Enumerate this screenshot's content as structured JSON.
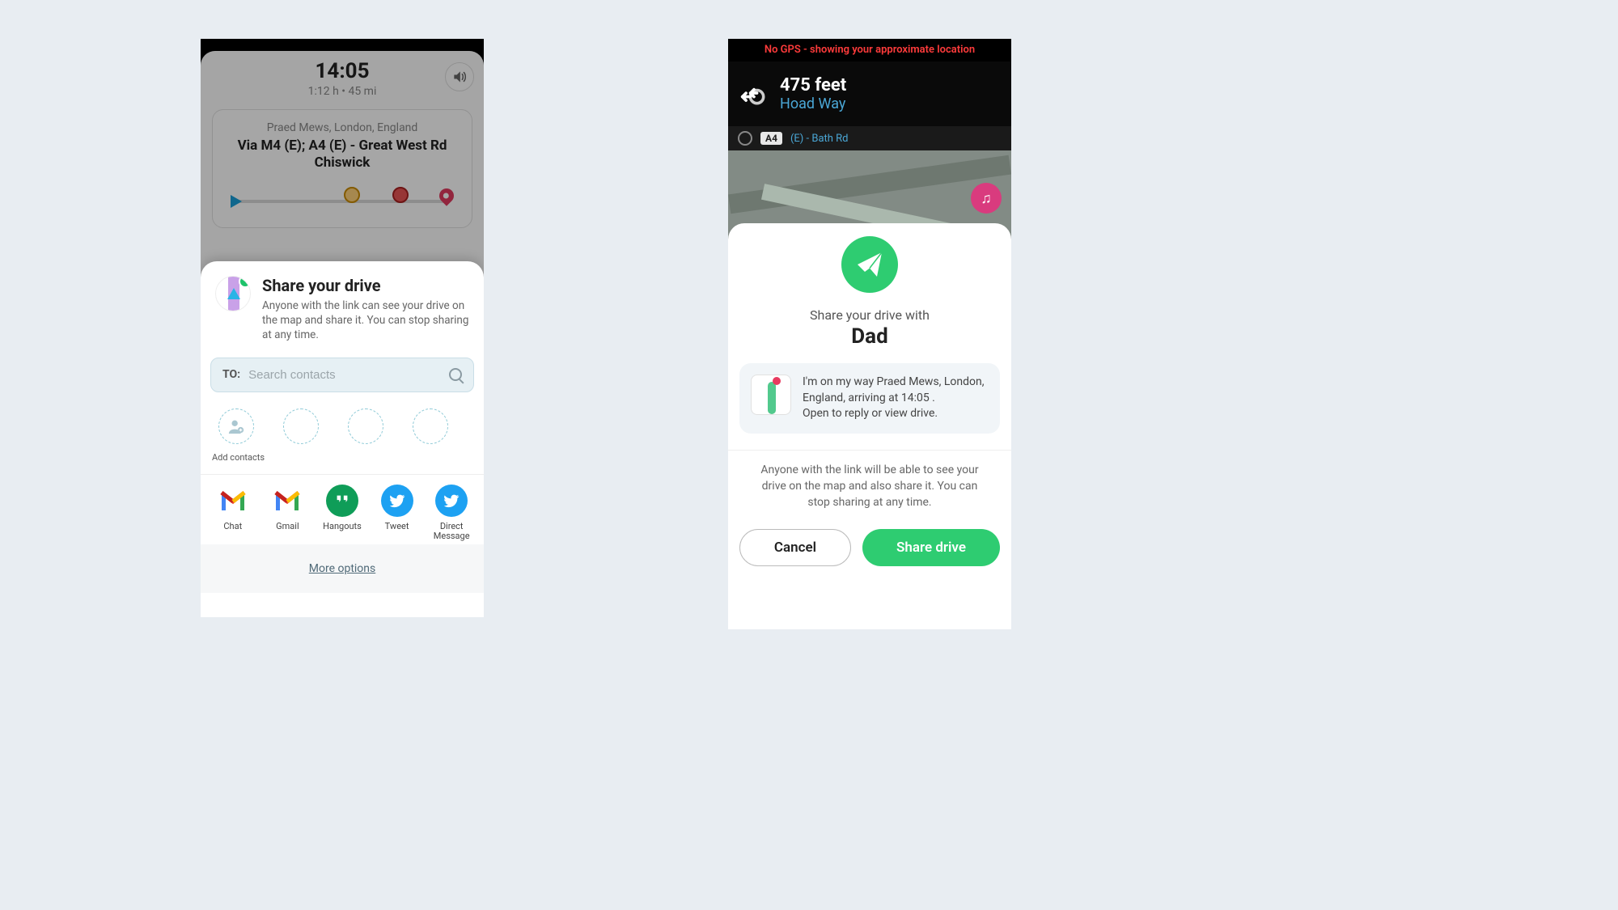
{
  "left": {
    "eta_time": "14:05",
    "eta_sub": "1:12 h • 45 mi",
    "sound_icon": "sound-on",
    "route": {
      "destination": "Praed Mews, London, England",
      "via": "Via M4 (E); A4 (E) - Great West Rd Chiswick"
    },
    "sheet": {
      "title": "Share your drive",
      "description": "Anyone with the link can see your drive on the map and share it. You can stop sharing at any time.",
      "search_label": "TO:",
      "search_placeholder": "Search contacts",
      "contacts_label": "Add contacts",
      "share_options": {
        "chat": "Chat",
        "gmail": "Gmail",
        "hangouts": "Hangouts",
        "tweet": "Tweet",
        "dm": "Direct Message"
      },
      "more": "More options"
    }
  },
  "right": {
    "gps_warning": "No GPS - showing your approximate location",
    "nav": {
      "distance": "475 feet",
      "street": "Hoad Way",
      "road_chip": "A4",
      "next_road": "(E) - Bath Rd"
    },
    "confirm": {
      "label": "Share your drive with",
      "name": "Dad",
      "message1": "I'm on my way Praed Mews, London, England, arriving at 14:05 .",
      "message2": "Open to reply or view drive.",
      "description": "Anyone with the link will be able to see your drive on the map and also share it. You can stop sharing at any time.",
      "cancel": "Cancel",
      "share": "Share drive"
    }
  }
}
